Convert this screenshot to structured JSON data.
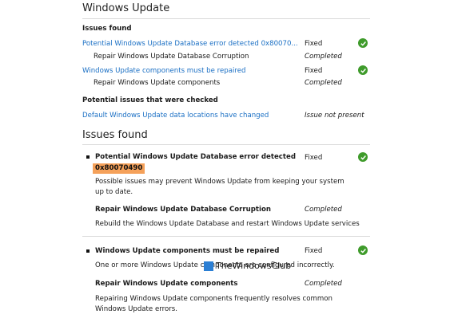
{
  "summary": {
    "title": "Windows Update",
    "issues_heading": "Issues found",
    "issues": [
      {
        "link": "Potential Windows Update Database error detected 0x80070...",
        "status": "Fixed",
        "subtext": "Repair Windows Update Database Corruption",
        "substatus": "Completed"
      },
      {
        "link": "Windows Update components must be repaired",
        "status": "Fixed",
        "subtext": "Repair Windows Update components",
        "substatus": "Completed"
      }
    ],
    "checked_heading": "Potential issues that were checked",
    "checked": {
      "link": "Default Windows Update data locations have changed",
      "status": "Issue not present"
    }
  },
  "details": {
    "heading": "Issues found",
    "items": [
      {
        "title": "Potential Windows Update Database error detected",
        "code": "0x80070490",
        "status": "Fixed",
        "description": "Possible issues may prevent Windows Update from keeping your system up to date.",
        "fix_title": "Repair Windows Update Database Corruption",
        "fix_status": "Completed",
        "fix_description": "Rebuild the Windows Update Database and restart Windows Update services"
      },
      {
        "title": "Windows Update components must be repaired",
        "status": "Fixed",
        "description": "One or more Windows Update components are configured incorrectly.",
        "fix_title": "Repair Windows Update components",
        "fix_status": "Completed",
        "fix_description": "Repairing Windows Update components frequently resolves common Windows Update errors."
      }
    ]
  },
  "watermark": "TheWindowsClub",
  "colors": {
    "link": "#1a6fc4",
    "check": "#3f9b2b",
    "highlight": "#f5a15a"
  },
  "icons": {
    "fixed": "check-circle-icon",
    "bullet": "bullet-icon"
  }
}
